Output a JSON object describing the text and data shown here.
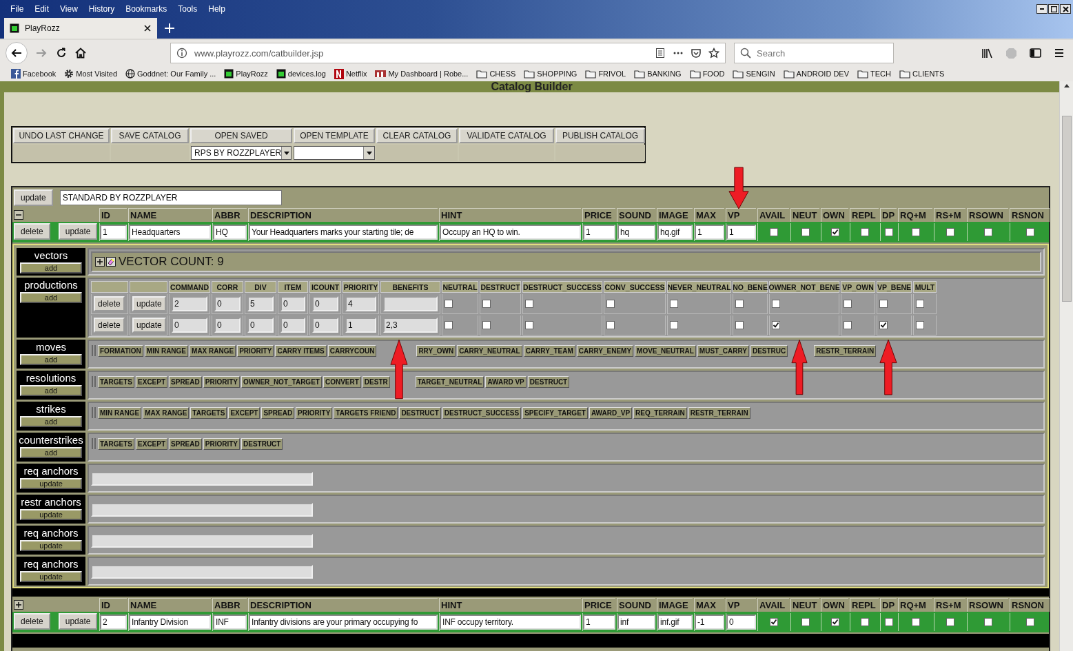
{
  "browser": {
    "menu": [
      "File",
      "Edit",
      "View",
      "History",
      "Bookmarks",
      "Tools",
      "Help"
    ],
    "tab": {
      "title": "PlayRozz"
    },
    "url": "www.playrozz.com/catbuilder.jsp",
    "search": {
      "placeholder": "Search"
    },
    "bookmarks": [
      {
        "label": "Facebook",
        "kind": "facebook"
      },
      {
        "label": "Most Visited",
        "kind": "gear"
      },
      {
        "label": "Goddnet: Our Family ...",
        "kind": "globe"
      },
      {
        "label": "PlayRozz",
        "kind": "site"
      },
      {
        "label": "devices.log",
        "kind": "site"
      },
      {
        "label": "Netflix",
        "kind": "netflix"
      },
      {
        "label": "My Dashboard | Robe...",
        "kind": "rh"
      },
      {
        "label": "CHESS",
        "kind": "folder"
      },
      {
        "label": "SHOPPING",
        "kind": "folder"
      },
      {
        "label": "FRIVOL",
        "kind": "folder"
      },
      {
        "label": "BANKING",
        "kind": "folder"
      },
      {
        "label": "FOOD",
        "kind": "folder"
      },
      {
        "label": "SENGIN",
        "kind": "folder"
      },
      {
        "label": "ANDROID DEV",
        "kind": "folder"
      },
      {
        "label": "TECH",
        "kind": "folder"
      },
      {
        "label": "CLIENTS",
        "kind": "folder"
      }
    ]
  },
  "page": {
    "title": "Catalog Builder",
    "actions": [
      {
        "label": "UNDO LAST CHANGE",
        "kind": "plain"
      },
      {
        "label": "SAVE CATALOG",
        "kind": "plain"
      },
      {
        "label": "OPEN SAVED",
        "kind": "select",
        "value": "RPS BY ROZZPLAYER"
      },
      {
        "label": "OPEN TEMPLATE",
        "kind": "select"
      },
      {
        "label": "CLEAR CATALOG",
        "kind": "plain"
      },
      {
        "label": "VALIDATE CATALOG",
        "kind": "plain"
      },
      {
        "label": "PUBLISH CATALOG",
        "kind": "plain"
      }
    ]
  },
  "catalog": {
    "update_label": "update",
    "name": "STANDARD BY ROZZPLAYER",
    "records": [
      {
        "expanded": true,
        "columns": [
          "ID",
          "NAME",
          "ABBR",
          "DESCRIPTION",
          "HINT",
          "PRICE",
          "SOUND",
          "IMAGE",
          "MAX",
          "VP",
          "AVAIL",
          "NEUT",
          "OWN",
          "REPL",
          "DP",
          "RQ+M",
          "RS+M",
          "RSOWN",
          "RSNON"
        ],
        "delete_label": "delete",
        "update_label": "update",
        "values": [
          "1",
          "Headquarters",
          "HQ",
          "Your Headquarters marks your starting tile; de",
          "Occupy an HQ to win.",
          "1",
          "hq",
          "hq.gif",
          "1",
          "1"
        ],
        "flags": [
          false,
          false,
          true,
          false,
          false,
          false,
          false,
          false,
          false
        ],
        "sections": [
          {
            "kind": "vectors",
            "title": "vectors",
            "button": "add",
            "count_label": "VECTOR COUNT: 9"
          },
          {
            "kind": "table",
            "title": "productions",
            "button": "add",
            "columns": [
              "COMMAND",
              "CORR",
              "DIV",
              "ITEM",
              "ICOUNT",
              "PRIORITY",
              "BENEFITS",
              "NEUTRAL",
              "DESTRUCT",
              "DESTRUCT_SUCCESS",
              "CONV_SUCCESS",
              "NEVER_NEUTRAL",
              "NO_BENE",
              "OWNER_NOT_BENE",
              "VP_OWN",
              "VP_BENE",
              "MULT"
            ],
            "rows": [
              {
                "delete_label": "delete",
                "update_label": "update",
                "values": [
                  "2",
                  "0",
                  "5",
                  "0",
                  "0",
                  "4"
                ],
                "flags": [
                  false,
                  false,
                  false,
                  false,
                  false,
                  false,
                  false,
                  false,
                  false,
                  false
                ]
              },
              {
                "delete_label": "delete",
                "update_label": "update",
                "values": [
                  "0",
                  "0",
                  "0",
                  "0",
                  "0",
                  "1"
                ],
                "benefits": "2,3",
                "flags": [
                  false,
                  false,
                  false,
                  false,
                  false,
                  false,
                  true,
                  false,
                  true,
                  false
                ]
              }
            ]
          },
          {
            "kind": "chips",
            "title": "moves",
            "button": "add",
            "chips": [
              "FORMATION",
              "MIN RANGE",
              "MAX RANGE",
              "PRIORITY",
              "CARRY ITEMS",
              "CARRYCOUN",
              "RRY_OWN",
              "CARRY_NEUTRAL",
              "CARRY_TEAM",
              "CARRY_ENEMY",
              "MOVE_NEUTRAL",
              "MUST_CARRY",
              "DESTRUC",
              "RESTR_TERRAIN"
            ]
          },
          {
            "kind": "chips",
            "title": "resolutions",
            "button": "add",
            "chips": [
              "TARGETS",
              "EXCEPT",
              "SPREAD",
              "PRIORITY",
              "OWNER_NOT_TARGET",
              "CONVERT",
              "DESTR",
              "TARGET_NEUTRAL",
              "AWARD VP",
              "DESTRUCT"
            ]
          },
          {
            "kind": "chips",
            "title": "strikes",
            "button": "add",
            "chips": [
              "MIN RANGE",
              "MAX RANGE",
              "TARGETS",
              "EXCEPT",
              "SPREAD",
              "PRIORITY",
              "TARGETS FRIEND",
              "DESTRUCT",
              "DESTRUCT_SUCCESS",
              "SPECIFY_TARGET",
              "AWARD_VP",
              "REQ_TERRAIN",
              "RESTR_TERRAIN"
            ]
          },
          {
            "kind": "chips",
            "title": "counterstrikes",
            "button": "add",
            "chips": [
              "TARGETS",
              "EXCEPT",
              "SPREAD",
              "PRIORITY",
              "DESTRUCT"
            ]
          },
          {
            "kind": "anchor",
            "title": "req anchors",
            "button": "update"
          },
          {
            "kind": "anchor",
            "title": "restr anchors",
            "button": "update"
          },
          {
            "kind": "anchor",
            "title": "req anchors",
            "button": "update"
          },
          {
            "kind": "anchor",
            "title": "req anchors",
            "button": "update"
          }
        ]
      },
      {
        "expanded": false,
        "columns": [
          "ID",
          "NAME",
          "ABBR",
          "DESCRIPTION",
          "HINT",
          "PRICE",
          "SOUND",
          "IMAGE",
          "MAX",
          "VP",
          "AVAIL",
          "NEUT",
          "OWN",
          "REPL",
          "DP",
          "RQ+M",
          "RS+M",
          "RSOWN",
          "RSNON"
        ],
        "delete_label": "delete",
        "update_label": "update",
        "values": [
          "2",
          "Infantry Division",
          "INF",
          "Infantry divisions are your primary occupying fo",
          "INF occupy territory.",
          "1",
          "inf",
          "inf.gif",
          "-1",
          "0"
        ],
        "flags": [
          true,
          false,
          true,
          false,
          false,
          false,
          false,
          false,
          false
        ]
      }
    ]
  },
  "annotations": [
    {
      "kind": "down_arrow"
    },
    {
      "kind": "up_arrow"
    },
    {
      "kind": "up_arrow"
    },
    {
      "kind": "up_arrow"
    }
  ]
}
